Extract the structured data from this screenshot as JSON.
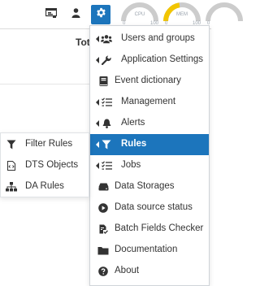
{
  "topbar": {
    "icons": [
      "report-icon",
      "user-icon",
      "gear-icon"
    ],
    "gauges": [
      {
        "label": "CPU",
        "min": "0",
        "max": "100",
        "value": 0,
        "color": "#cccccc"
      },
      {
        "label": "MEM",
        "min": "0",
        "max": "100",
        "value": 45,
        "color": "#f2c500"
      },
      {
        "label": "",
        "min": "0",
        "max": "",
        "value": 0,
        "color": "#cccccc"
      }
    ]
  },
  "main": {
    "title_fragment": "Tot"
  },
  "menu": {
    "items": [
      {
        "label": "Users and groups",
        "icon": "users-icon",
        "submenu": true
      },
      {
        "label": "Application Settings",
        "icon": "wrench-icon",
        "submenu": true
      },
      {
        "label": "Event dictionary",
        "icon": "book-icon",
        "submenu": false
      },
      {
        "label": "Management",
        "icon": "tasks-icon",
        "submenu": true
      },
      {
        "label": "Alerts",
        "icon": "bell-icon",
        "submenu": true
      },
      {
        "label": "Rules",
        "icon": "filter-icon",
        "submenu": true,
        "active": true
      },
      {
        "label": "Jobs",
        "icon": "tasks-icon",
        "submenu": true
      },
      {
        "label": "Data Storages",
        "icon": "hdd-icon",
        "submenu": false
      },
      {
        "label": "Data source status",
        "icon": "play-circle-icon",
        "submenu": false
      },
      {
        "label": "Batch Fields Checker",
        "icon": "file-check-icon",
        "submenu": false
      },
      {
        "label": "Documentation",
        "icon": "folder-icon",
        "submenu": false
      },
      {
        "label": "About",
        "icon": "question-circle-icon",
        "submenu": false
      }
    ]
  },
  "submenu": {
    "items": [
      {
        "label": "Filter Rules",
        "icon": "filter-icon"
      },
      {
        "label": "DTS Objects",
        "icon": "file-code-icon"
      },
      {
        "label": "DA Rules",
        "icon": "sitemap-icon"
      }
    ]
  },
  "colors": {
    "accent": "#1c75bc",
    "text": "#333333"
  }
}
